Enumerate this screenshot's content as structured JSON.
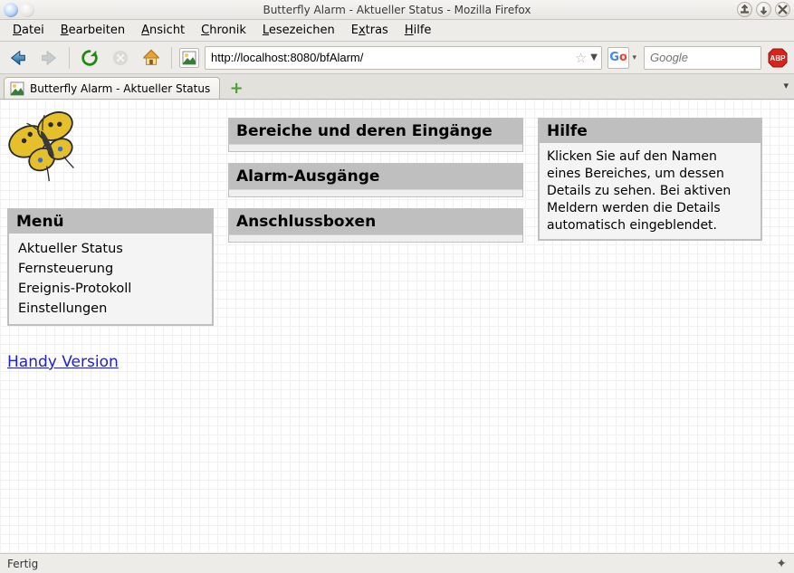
{
  "window": {
    "title": "Butterfly Alarm - Aktueller Status - Mozilla Firefox"
  },
  "menubar": {
    "items": [
      "Datei",
      "Bearbeiten",
      "Ansicht",
      "Chronik",
      "Lesezeichen",
      "Extras",
      "Hilfe"
    ]
  },
  "url": "http://localhost:8080/bfAlarm/",
  "search": {
    "placeholder": "Google"
  },
  "tabs": {
    "active": "Butterfly Alarm - Aktueller Status"
  },
  "page": {
    "menu": {
      "title": "Menü",
      "items": [
        "Aktueller Status",
        "Fernsteuerung",
        "Ereignis-Protokoll",
        "Einstellungen"
      ]
    },
    "handy_link": "Handy Version",
    "sections": {
      "areas": "Bereiche und deren Eingänge",
      "outputs": "Alarm-Ausgänge",
      "boxes": "Anschlussboxen"
    },
    "help": {
      "title": "Hilfe",
      "text": "Klicken Sie auf den Namen eines Bereiches, um dessen Details zu sehen. Bei aktiven Meldern werden die Details automatisch eingeblendet."
    }
  },
  "status": {
    "text": "Fertig"
  }
}
